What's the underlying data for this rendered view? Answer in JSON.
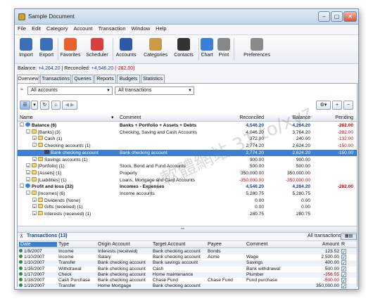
{
  "window": {
    "title": "Sample Document",
    "min": "–",
    "max": "▢",
    "close": "✕"
  },
  "menu": [
    "File",
    "Edit",
    "Category",
    "Account",
    "Transaction",
    "Window",
    "Help"
  ],
  "toolbar": [
    {
      "label": "Import",
      "icon": "import-icon",
      "color": "#3c6fb8"
    },
    {
      "label": "Export",
      "icon": "export-icon",
      "color": "#3c6fb8"
    },
    {
      "label": "Favorites",
      "icon": "heart-icon",
      "color": "#e8602c"
    },
    {
      "label": "Scheduler",
      "icon": "calendar-icon",
      "color": "#d84040"
    },
    {
      "label": "Accounts",
      "icon": "accounts-icon",
      "color": "#2d5aa8"
    },
    {
      "label": "Categories",
      "icon": "categories-icon",
      "color": "#c89a4a"
    },
    {
      "label": "Contacts",
      "icon": "contacts-icon",
      "color": "#333333"
    },
    {
      "label": "Chart",
      "icon": "chart-icon",
      "color": "#3c7fd8"
    },
    {
      "label": "Print",
      "icon": "print-icon",
      "color": "#888888"
    },
    {
      "label": "Preferences",
      "icon": "preferences-icon",
      "color": "#8a8a8a"
    }
  ],
  "status": {
    "balance_label": "Balance: ",
    "balance": "+4,264.20",
    "sep": " | Reconciled: ",
    "reconciled": "+4,546.20",
    "pending": " (-282.00)"
  },
  "tabs": [
    "Overview",
    "Transactions",
    "Queries",
    "Reports",
    "Budgets",
    "Statistics"
  ],
  "filters": {
    "accounts": "All accounts",
    "transactions": "All transactions"
  },
  "account_columns": [
    "Name",
    "Comment",
    "Reconciled",
    "Balance",
    "Pending"
  ],
  "accounts": [
    {
      "indent": 0,
      "expand": "−",
      "name": "Balance (6)",
      "comment": "Banks + Portfolio + Assets + Debts",
      "rec": "4,546.20",
      "bal": "4,264.20",
      "pend": "-282.00",
      "bold": true,
      "icon": "globe"
    },
    {
      "indent": 1,
      "expand": "−",
      "name": "[Banks] (3)",
      "comment": "Checking, Saving and Cash Accounts",
      "rec": "4,046.20",
      "bal": "3,764.20",
      "pend": "-282.00",
      "icon": "folder"
    },
    {
      "indent": 2,
      "expand": "+",
      "name": "Cash (1)",
      "comment": "",
      "rec": "372.00",
      "bal": "240.00",
      "pend": "-132.00",
      "icon": "folder"
    },
    {
      "indent": 2,
      "expand": "−",
      "name": "Checking accounts (1)",
      "comment": "",
      "rec": "2,774.20",
      "bal": "2,624.20",
      "pend": "-150.00",
      "icon": "folder"
    },
    {
      "indent": 3,
      "expand": "",
      "name": "Bank checking account",
      "comment": "Bank checking account",
      "rec": "2,774.20",
      "bal": "2,624.20",
      "pend": "-150.00",
      "icon": "acct",
      "selected": true
    },
    {
      "indent": 2,
      "expand": "+",
      "name": "Savings accounts (1)",
      "comment": "",
      "rec": "900.00",
      "bal": "900.00",
      "pend": "",
      "icon": "folder"
    },
    {
      "indent": 1,
      "expand": "+",
      "name": "[Portfolio] (1)",
      "comment": "Stock, Bond and Fund Accounts",
      "rec": "500.00",
      "bal": "500.00",
      "pend": "",
      "icon": "folder"
    },
    {
      "indent": 1,
      "expand": "+",
      "name": "[Assets] (1)",
      "comment": "Property",
      "rec": "350,000.00",
      "bal": "350,000.00",
      "pend": "",
      "icon": "folder"
    },
    {
      "indent": 1,
      "expand": "+",
      "name": "[Liabilities] (1)",
      "comment": "Loans, Mortgage and Card Accounts",
      "rec": "-350,000.00",
      "bal": "-350,000.00",
      "pend": "",
      "icon": "folder"
    },
    {
      "indent": 0,
      "expand": "−",
      "name": "Profit and loss (32)",
      "comment": "Incomes - Expenses",
      "rec": "4,546.20",
      "bal": "4,264.20",
      "pend": "-282.00",
      "bold": true,
      "icon": "globe"
    },
    {
      "indent": 1,
      "expand": "−",
      "name": "[Incomes] (6)",
      "comment": "Income accounts",
      "rec": "5,280.75",
      "bal": "5,280.75",
      "pend": "",
      "icon": "folder"
    },
    {
      "indent": 2,
      "expand": "+",
      "name": "Dividends (None)",
      "comment": "",
      "rec": "0.00",
      "bal": "0.00",
      "pend": "",
      "icon": "folder"
    },
    {
      "indent": 2,
      "expand": "+",
      "name": "Gifts (received) (1)",
      "comment": "",
      "rec": "0.00",
      "bal": "0.00",
      "pend": "",
      "icon": "folder"
    },
    {
      "indent": 2,
      "expand": "+",
      "name": "Interests (received) (1)",
      "comment": "",
      "rec": "280.75",
      "bal": "280.75",
      "pend": "",
      "icon": "folder"
    }
  ],
  "transactions_bar": {
    "title": "Transactions (13)",
    "filter": "All transactions"
  },
  "txn_columns": [
    "Date",
    "Type",
    "Origin Account",
    "Target Account",
    "Payee",
    "Comment",
    "Amount",
    "R"
  ],
  "transactions": [
    {
      "date": "1/9/2007",
      "type": "Income",
      "origin": "Interests (received)",
      "target": "Bank checking account",
      "payee": "Bonds",
      "comment": "",
      "amount": "123.52",
      "neg": false
    },
    {
      "date": "1/10/2007",
      "type": "Income",
      "origin": "Salary",
      "target": "Bank checking account",
      "payee": "Acme",
      "comment": "Wage",
      "amount": "2,500.00",
      "neg": false
    },
    {
      "date": "1/10/2007",
      "type": "Transfer",
      "origin": "Bank checking account",
      "target": "Bank savings account",
      "payee": "",
      "comment": "Savings",
      "amount": "400.00",
      "neg": false
    },
    {
      "date": "1/16/2007",
      "type": "Withdrawal",
      "origin": "Bank checking account",
      "target": "Cash",
      "payee": "",
      "comment": "Bank withdrawal",
      "amount": "500.00",
      "neg": false
    },
    {
      "date": "1/17/2007",
      "type": "Check",
      "origin": "Bank checking account",
      "target": "Home maintenance",
      "payee": "",
      "comment": "Plumber",
      "amount": "-356.55",
      "neg": true
    },
    {
      "date": "1/18/2007",
      "type": "Cash Purchase",
      "origin": "Bank checking account",
      "target": "Chase Fund",
      "payee": "Chase Fund",
      "comment": "Fund purchase",
      "amount": "-500.00",
      "neg": true
    },
    {
      "date": "1/19/2007",
      "type": "Transfer",
      "origin": "Home Mortgage",
      "target": "Bank checking account",
      "payee": "",
      "comment": "",
      "amount": "350,000.00",
      "neg": false
    }
  ],
  "watermark": "yz軟體網站 31.to/xyz"
}
